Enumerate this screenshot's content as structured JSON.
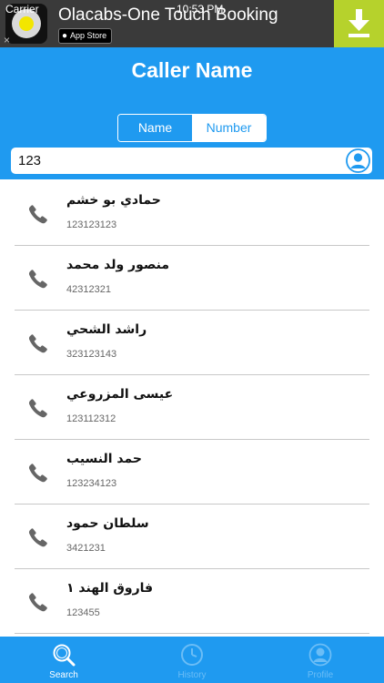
{
  "status_bar": {
    "carrier": "Carrier",
    "time": "10:53 PM"
  },
  "ad": {
    "title": "Olacabs-One Touch Booking",
    "store_badge": "App Store",
    "close": "×",
    "icon": "download-icon"
  },
  "header": {
    "title": "Caller Name",
    "tabs": [
      {
        "label": "Name",
        "selected": true
      },
      {
        "label": "Number",
        "selected": false
      }
    ]
  },
  "search": {
    "value": "123",
    "placeholder": ""
  },
  "results": [
    {
      "name": "حمادي بو خشم",
      "number": "123123123"
    },
    {
      "name": "منصور ولد محمد",
      "number": "42312321"
    },
    {
      "name": "راشد الشحي",
      "number": "323123143"
    },
    {
      "name": "عيسى المزروعي",
      "number": "123112312"
    },
    {
      "name": "حمد النسيب",
      "number": "123234123"
    },
    {
      "name": "سلطان حمود",
      "number": "3421231"
    },
    {
      "name": "فاروق الهند ١",
      "number": "123455"
    }
  ],
  "tabbar": {
    "items": [
      {
        "label": "Search",
        "icon": "search-icon",
        "active": true
      },
      {
        "label": "History",
        "icon": "history-icon",
        "active": false
      },
      {
        "label": "Profile",
        "icon": "profile-icon",
        "active": false
      }
    ]
  },
  "colors": {
    "primary": "#1f9af0",
    "ad_background": "#3a3a3a",
    "ad_download": "#b6d22c"
  }
}
